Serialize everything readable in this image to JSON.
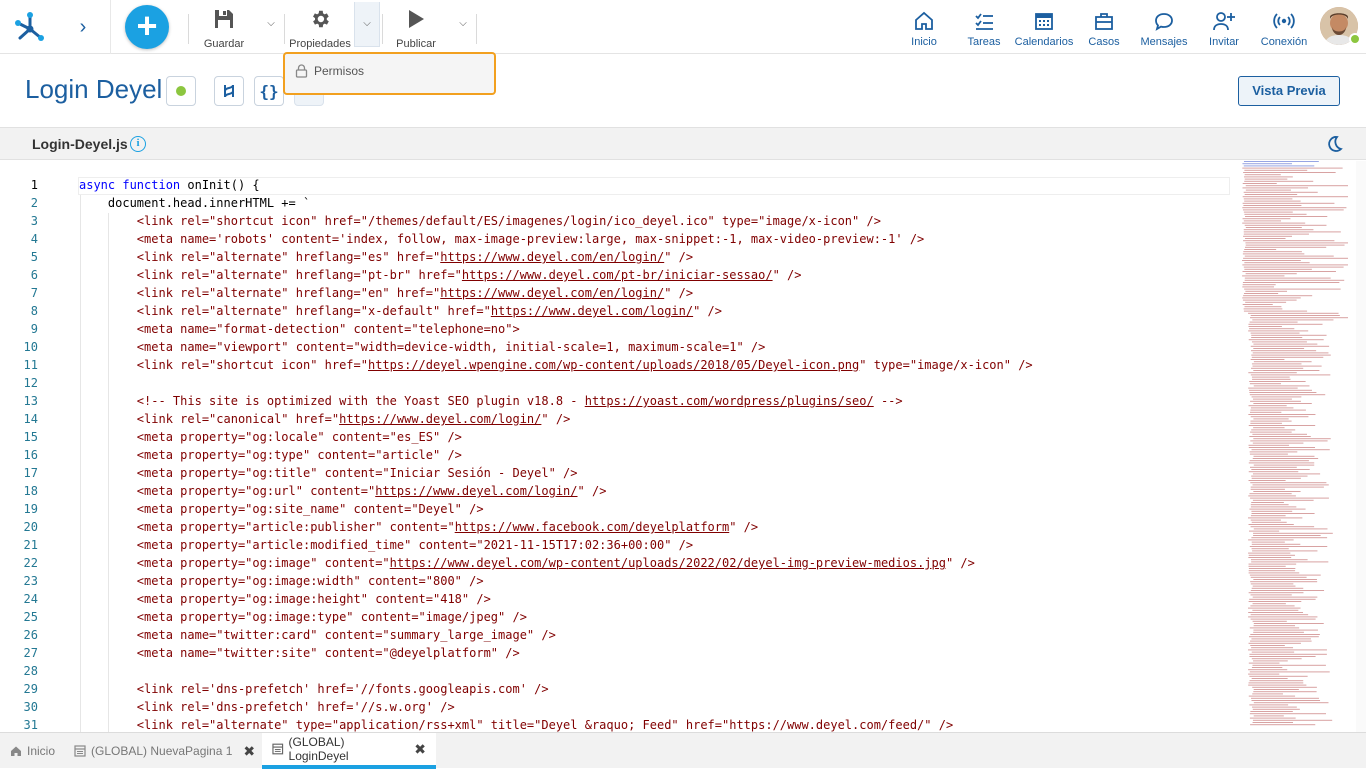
{
  "toolbar": {
    "save_label": "Guardar",
    "properties_label": "Propiedades",
    "publish_label": "Publicar",
    "dropdown_item": "Permisos"
  },
  "nav": [
    {
      "label": "Inicio",
      "icon": "home-icon"
    },
    {
      "label": "Tareas",
      "icon": "tasks-icon"
    },
    {
      "label": "Calendarios",
      "icon": "calendar-icon"
    },
    {
      "label": "Casos",
      "icon": "briefcase-icon"
    },
    {
      "label": "Mensajes",
      "icon": "chat-icon"
    },
    {
      "label": "Invitar",
      "icon": "invite-user-icon"
    },
    {
      "label": "Conexión",
      "icon": "connection-icon"
    }
  ],
  "page": {
    "title": "Login Deyel",
    "preview_label": "Vista Previa",
    "status_color": "#8cc63f"
  },
  "editor": {
    "file_name": "Login-Deyel.js",
    "current_line": 1,
    "lines": [
      [
        {
          "t": "kw",
          "v": "async function "
        },
        {
          "t": "ident",
          "v": "onInit() {"
        }
      ],
      [
        {
          "t": "ident",
          "v": "    document.head.innerHTML += `"
        }
      ],
      [
        {
          "t": "s",
          "v": "        <link rel=\"shortcut icon\" href=\"/themes/default/ES/imagenes/login/ico_deyel.ico\" type=\"image/x-icon\" />"
        }
      ],
      [
        {
          "t": "s",
          "v": "        <meta name='robots' content='index, follow, max-image-preview:large, max-snippet:-1, max-video-preview:-1' />"
        }
      ],
      [
        {
          "t": "s",
          "v": "        <link rel=\"alternate\" hreflang=\"es\" href=\""
        },
        {
          "t": "link",
          "v": "https://www.deyel.com/en/login/"
        },
        {
          "t": "s",
          "v": "\" />"
        }
      ],
      [
        {
          "t": "s",
          "v": "        <link rel=\"alternate\" hreflang=\"pt-br\" href=\""
        },
        {
          "t": "link",
          "v": "https://www.deyel.com/pt-br/iniciar-sessao/"
        },
        {
          "t": "s",
          "v": "\" />"
        }
      ],
      [
        {
          "t": "s",
          "v": "        <link rel=\"alternate\" hreflang=\"en\" href=\""
        },
        {
          "t": "link",
          "v": "https://www.deyel.com/en/login/"
        },
        {
          "t": "s",
          "v": "\" />"
        }
      ],
      [
        {
          "t": "s",
          "v": "        <link rel=\"alternate\" hreflang=\"x-default\" href=\""
        },
        {
          "t": "link",
          "v": "https://www.deyel.com/login/"
        },
        {
          "t": "s",
          "v": "\" />"
        }
      ],
      [
        {
          "t": "s",
          "v": "        <meta name=\"format-detection\" content=\"telephone=no\">"
        }
      ],
      [
        {
          "t": "s",
          "v": "        <meta name=\"viewport\" content=\"width=device-width, initial-scale=1, maximum-scale=1\" />"
        }
      ],
      [
        {
          "t": "s",
          "v": "        <link rel=\"shortcut icon\" href=\""
        },
        {
          "t": "link",
          "v": "https://deyel.wpengine.com/wp-content/uploads/2018/05/Deyel-icon.png"
        },
        {
          "t": "s",
          "v": "\" type=\"image/x-icon\" />"
        }
      ],
      [],
      [
        {
          "t": "s",
          "v": "        <!-- This site is optimized with the Yoast SEO plugin v18.8 - "
        },
        {
          "t": "link",
          "v": "https://yoast.com/wordpress/plugins/seo/"
        },
        {
          "t": "s",
          "v": " -->"
        }
      ],
      [
        {
          "t": "s",
          "v": "        <link rel=\"canonical\" href=\""
        },
        {
          "t": "link",
          "v": "https://www.deyel.com/login/"
        },
        {
          "t": "s",
          "v": "\" />"
        }
      ],
      [
        {
          "t": "s",
          "v": "        <meta property=\"og:locale\" content=\"es_ES\" />"
        }
      ],
      [
        {
          "t": "s",
          "v": "        <meta property=\"og:type\" content=\"article\" />"
        }
      ],
      [
        {
          "t": "s",
          "v": "        <meta property=\"og:title\" content=\"Iniciar Sesión - Deyel\" />"
        }
      ],
      [
        {
          "t": "s",
          "v": "        <meta property=\"og:url\" content=\""
        },
        {
          "t": "link",
          "v": "https://www.deyel.com/login/"
        },
        {
          "t": "s",
          "v": "\" />"
        }
      ],
      [
        {
          "t": "s",
          "v": "        <meta property=\"og:site_name\" content=\"Deyel\" />"
        }
      ],
      [
        {
          "t": "s",
          "v": "        <meta property=\"article:publisher\" content=\""
        },
        {
          "t": "link",
          "v": "https://www.facebook.com/deyelplatform"
        },
        {
          "t": "s",
          "v": "\" />"
        }
      ],
      [
        {
          "t": "s",
          "v": "        <meta property=\"article:modified_time\" content=\"2021-11-15T17:02:36+00:00\" />"
        }
      ],
      [
        {
          "t": "s",
          "v": "        <meta property=\"og:image\" content=\""
        },
        {
          "t": "link",
          "v": "https://www.deyel.com/wp-content/uploads/2022/02/deyel-img-preview-medios.jpg"
        },
        {
          "t": "s",
          "v": "\" />"
        }
      ],
      [
        {
          "t": "s",
          "v": "        <meta property=\"og:image:width\" content=\"800\" />"
        }
      ],
      [
        {
          "t": "s",
          "v": "        <meta property=\"og:image:height\" content=\"418\" />"
        }
      ],
      [
        {
          "t": "s",
          "v": "        <meta property=\"og:image:type\" content=\"image/jpeg\" />"
        }
      ],
      [
        {
          "t": "s",
          "v": "        <meta name=\"twitter:card\" content=\"summary_large_image\" />"
        }
      ],
      [
        {
          "t": "s",
          "v": "        <meta name=\"twitter:site\" content=\"@deyelplatform\" />"
        }
      ],
      [],
      [
        {
          "t": "s",
          "v": "        <link rel='dns-prefetch' href='//fonts.googleapis.com' />"
        }
      ],
      [
        {
          "t": "s",
          "v": "        <link rel='dns-prefetch' href='//s.w.org' />"
        }
      ],
      [
        {
          "t": "s",
          "v": "        <link rel=\"alternate\" type=\"application/rss+xml\" title=\"Deyel &raquo; Feed\" href=\"https://www.deyel.com/feed/\" />"
        }
      ]
    ]
  },
  "tabs": [
    {
      "label": "Inicio",
      "icon": "home-icon",
      "closable": false,
      "active": false
    },
    {
      "label": "(GLOBAL) NuevaPagina 1",
      "icon": "page-icon",
      "closable": true,
      "active": false
    },
    {
      "label": "(GLOBAL) LoginDeyel",
      "icon": "page-icon",
      "closable": true,
      "active": true
    }
  ],
  "colors": {
    "accent": "#1ba1e2",
    "brand_blue": "#1c5fa0",
    "highlight_border": "#f2a01f",
    "string": "#800000",
    "keyword": "#0000ff"
  }
}
